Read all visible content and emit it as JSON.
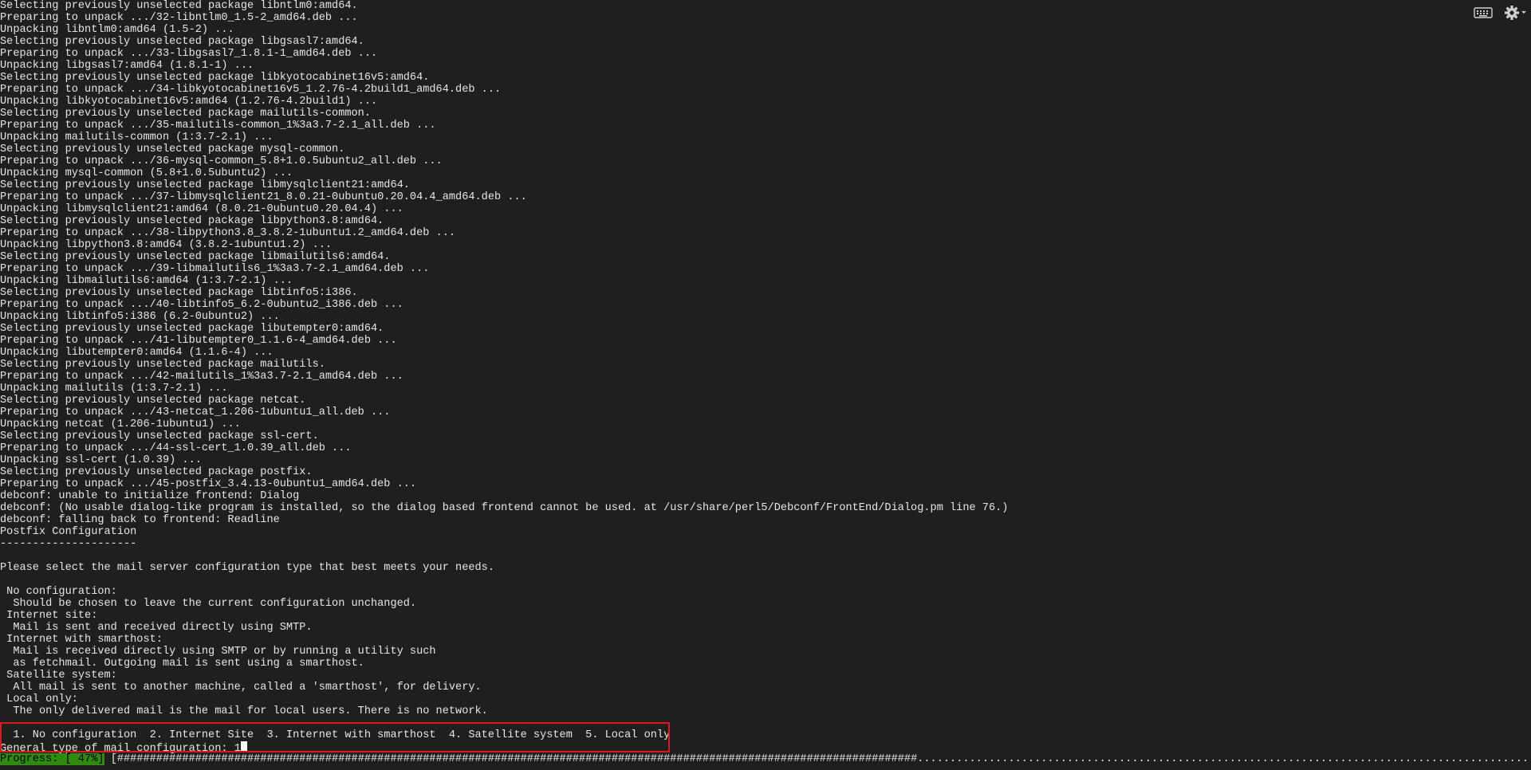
{
  "terminal": {
    "log_lines": [
      "Selecting previously unselected package libntlm0:amd64.",
      "Preparing to unpack .../32-libntlm0_1.5-2_amd64.deb ...",
      "Unpacking libntlm0:amd64 (1.5-2) ...",
      "Selecting previously unselected package libgsasl7:amd64.",
      "Preparing to unpack .../33-libgsasl7_1.8.1-1_amd64.deb ...",
      "Unpacking libgsasl7:amd64 (1.8.1-1) ...",
      "Selecting previously unselected package libkyotocabinet16v5:amd64.",
      "Preparing to unpack .../34-libkyotocabinet16v5_1.2.76-4.2build1_amd64.deb ...",
      "Unpacking libkyotocabinet16v5:amd64 (1.2.76-4.2build1) ...",
      "Selecting previously unselected package mailutils-common.",
      "Preparing to unpack .../35-mailutils-common_1%3a3.7-2.1_all.deb ...",
      "Unpacking mailutils-common (1:3.7-2.1) ...",
      "Selecting previously unselected package mysql-common.",
      "Preparing to unpack .../36-mysql-common_5.8+1.0.5ubuntu2_all.deb ...",
      "Unpacking mysql-common (5.8+1.0.5ubuntu2) ...",
      "Selecting previously unselected package libmysqlclient21:amd64.",
      "Preparing to unpack .../37-libmysqlclient21_8.0.21-0ubuntu0.20.04.4_amd64.deb ...",
      "Unpacking libmysqlclient21:amd64 (8.0.21-0ubuntu0.20.04.4) ...",
      "Selecting previously unselected package libpython3.8:amd64.",
      "Preparing to unpack .../38-libpython3.8_3.8.2-1ubuntu1.2_amd64.deb ...",
      "Unpacking libpython3.8:amd64 (3.8.2-1ubuntu1.2) ...",
      "Selecting previously unselected package libmailutils6:amd64.",
      "Preparing to unpack .../39-libmailutils6_1%3a3.7-2.1_amd64.deb ...",
      "Unpacking libmailutils6:amd64 (1:3.7-2.1) ...",
      "Selecting previously unselected package libtinfo5:i386.",
      "Preparing to unpack .../40-libtinfo5_6.2-0ubuntu2_i386.deb ...",
      "Unpacking libtinfo5:i386 (6.2-0ubuntu2) ...",
      "Selecting previously unselected package libutempter0:amd64.",
      "Preparing to unpack .../41-libutempter0_1.1.6-4_amd64.deb ...",
      "Unpacking libutempter0:amd64 (1.1.6-4) ...",
      "Selecting previously unselected package mailutils.",
      "Preparing to unpack .../42-mailutils_1%3a3.7-2.1_amd64.deb ...",
      "Unpacking mailutils (1:3.7-2.1) ...",
      "Selecting previously unselected package netcat.",
      "Preparing to unpack .../43-netcat_1.206-1ubuntu1_all.deb ...",
      "Unpacking netcat (1.206-1ubuntu1) ...",
      "Selecting previously unselected package ssl-cert.",
      "Preparing to unpack .../44-ssl-cert_1.0.39_all.deb ...",
      "Unpacking ssl-cert (1.0.39) ...",
      "Selecting previously unselected package postfix.",
      "Preparing to unpack .../45-postfix_3.4.13-0ubuntu1_amd64.deb ...",
      "debconf: unable to initialize frontend: Dialog",
      "debconf: (No usable dialog-like program is installed, so the dialog based frontend cannot be used. at /usr/share/perl5/Debconf/FrontEnd/Dialog.pm line 76.)",
      "debconf: falling back to frontend: Readline",
      "Postfix Configuration",
      "---------------------",
      "",
      "Please select the mail server configuration type that best meets your needs.",
      "",
      " No configuration:",
      "  Should be chosen to leave the current configuration unchanged.",
      " Internet site:",
      "  Mail is sent and received directly using SMTP.",
      " Internet with smarthost:",
      "  Mail is received directly using SMTP or by running a utility such",
      "  as fetchmail. Outgoing mail is sent using a smarthost.",
      " Satellite system:",
      "  All mail is sent to another machine, called a 'smarthost', for delivery.",
      " Local only:",
      "  The only delivered mail is the mail for local users. There is no network.",
      ""
    ],
    "options_line": "  1. No configuration  2. Internet Site  3. Internet with smarthost  4. Satellite system  5. Local only",
    "prompt_text": "General type of mail configuration: ",
    "prompt_value": "1",
    "progress_label": "Progress: [ 47%]",
    "progress_percent": 47,
    "progress_bar_width_chars": 261
  },
  "toolbar": {
    "keyboard_icon": "keyboard-icon",
    "settings_icon": "gear-icon"
  },
  "colors": {
    "background": "#1f1f1f",
    "text": "#e6e6e6",
    "highlight_border": "#e0171c",
    "progress_label_bg": "#2e8b0e"
  }
}
